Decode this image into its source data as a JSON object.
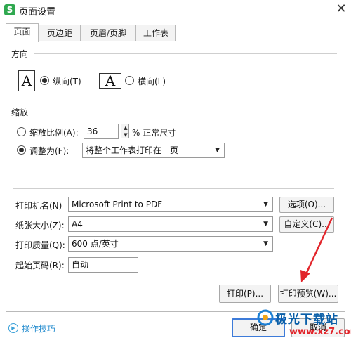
{
  "window": {
    "title": "页面设置",
    "app_icon_letter": "S",
    "close_glyph": "✕"
  },
  "tabs": [
    {
      "label": "页面",
      "active": true
    },
    {
      "label": "页边距",
      "active": false
    },
    {
      "label": "页眉/页脚",
      "active": false
    },
    {
      "label": "工作表",
      "active": false
    }
  ],
  "orientation": {
    "group_label": "方向",
    "portrait": {
      "glyph": "A",
      "label": "纵向(T)",
      "checked": true
    },
    "landscape": {
      "glyph": "A",
      "label": "横向(L)",
      "checked": false
    }
  },
  "scaling": {
    "group_label": "缩放",
    "scale_ratio": {
      "label": "缩放比例(A):",
      "checked": false,
      "value": "36",
      "suffix": "% 正常尺寸"
    },
    "fit_to": {
      "label": "调整为(F):",
      "checked": true,
      "selected": "将整个工作表打印在一页"
    }
  },
  "printer": {
    "name_label": "打印机名(N)",
    "name_value": "Microsoft Print to PDF",
    "options_button": "选项(O)...",
    "paper_label": "纸张大小(Z):",
    "paper_value": "A4",
    "custom_button": "自定义(C)...",
    "quality_label": "打印质量(Q):",
    "quality_value": "600 点/英寸",
    "start_page_label": "起始页码(R):",
    "start_page_value": "自动"
  },
  "actions": {
    "print_button": "打印(P)...",
    "preview_button": "打印预览(W)..."
  },
  "footer": {
    "help_icon": "play-circle-icon",
    "help_link": "操作技巧",
    "ok_button": "确定",
    "cancel_button": "取消"
  },
  "watermark": {
    "title": "极光下载站",
    "url": "www.xz7.com"
  },
  "colors": {
    "accent_blue": "#3d7bd9",
    "annotation_red": "#e2252b",
    "app_green": "#2fa84f"
  }
}
